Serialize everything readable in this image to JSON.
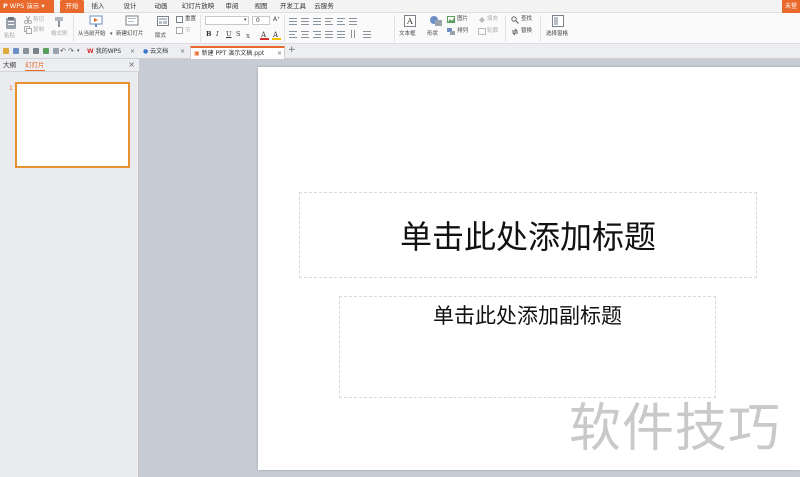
{
  "app": {
    "name": "WPS 演示",
    "user_button": "未登"
  },
  "menu": {
    "tabs": [
      "开始",
      "插入",
      "设计",
      "动画",
      "幻灯片放映",
      "审阅",
      "视图",
      "开发工具",
      "云服务"
    ],
    "active": "开始"
  },
  "ribbon": {
    "paste": "粘贴",
    "cut": "剪切",
    "copy": "复制",
    "format_painter": "格式刷",
    "from_current": "从当前开始",
    "new_slide": "新建幻灯片",
    "layout": "版式",
    "reset": "重置",
    "section": "节",
    "font_size": "0",
    "bold": "B",
    "italic": "I",
    "underline": "U",
    "strike": "S",
    "text_box": "文本框",
    "shape": "形状",
    "picture": "图片",
    "fill": "填充",
    "arrange": "排列",
    "outline": "轮廓",
    "find": "查找",
    "replace": "替换",
    "select_pane": "选择窗格"
  },
  "doc_tabs": [
    {
      "label": "我的WPS",
      "active": false
    },
    {
      "label": "云文档",
      "active": false
    },
    {
      "label": "新建 PPT 演示文稿.ppt",
      "active": true
    }
  ],
  "add_tab": "+",
  "panel": {
    "tabs": [
      "大纲",
      "幻灯片"
    ],
    "active": "幻灯片",
    "close": "×",
    "slide_number": "1"
  },
  "slide": {
    "title_placeholder": "单击此处添加标题",
    "subtitle_placeholder": "单击此处添加副标题"
  },
  "watermark": "软件技巧",
  "colors": {
    "accent": "#e8692b",
    "thumb_border": "#e8912f"
  }
}
